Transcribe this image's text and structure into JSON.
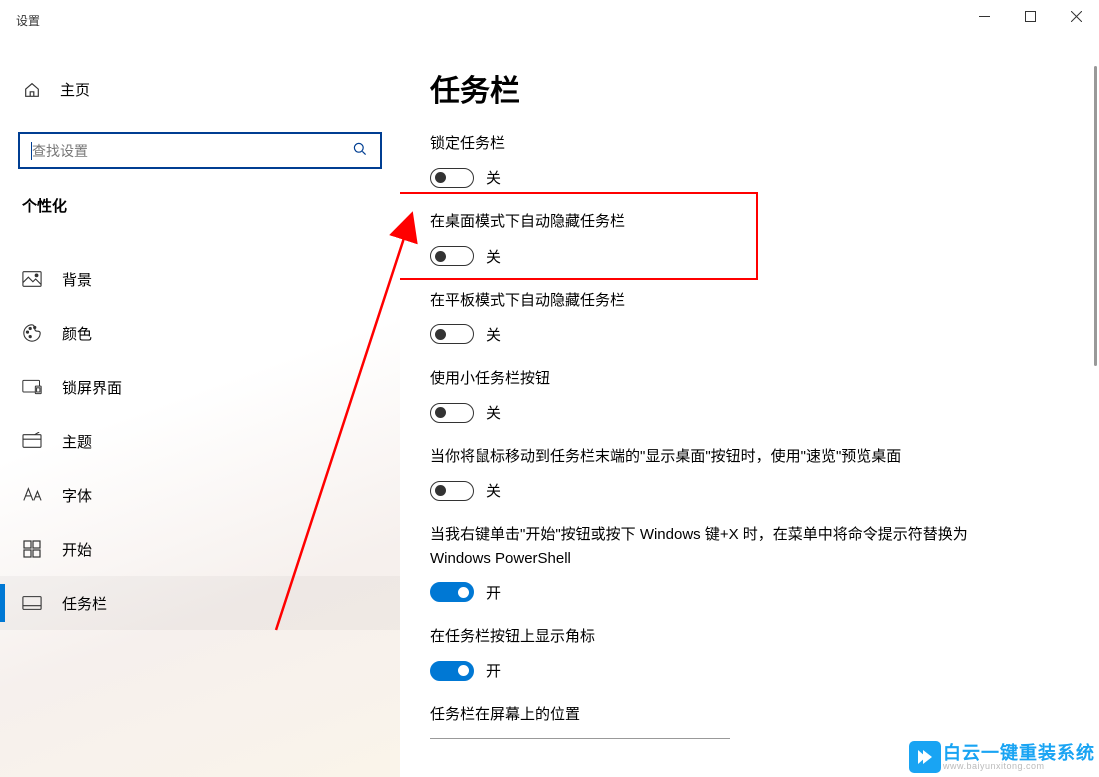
{
  "app_title": "设置",
  "home_label": "主页",
  "search": {
    "placeholder": "查找设置"
  },
  "category": "个性化",
  "sidebar_items": [
    {
      "label": "背景",
      "icon": "picture-icon"
    },
    {
      "label": "颜色",
      "icon": "palette-icon"
    },
    {
      "label": "锁屏界面",
      "icon": "lockscreen-icon"
    },
    {
      "label": "主题",
      "icon": "theme-icon"
    },
    {
      "label": "字体",
      "icon": "font-icon"
    },
    {
      "label": "开始",
      "icon": "start-icon"
    },
    {
      "label": "任务栏",
      "icon": "taskbar-icon",
      "active": true
    }
  ],
  "page_title": "任务栏",
  "settings": [
    {
      "label": "锁定任务栏",
      "state": "off",
      "state_text": "关"
    },
    {
      "label": "在桌面模式下自动隐藏任务栏",
      "state": "off",
      "state_text": "关",
      "highlighted": true
    },
    {
      "label": "在平板模式下自动隐藏任务栏",
      "state": "off",
      "state_text": "关"
    },
    {
      "label": "使用小任务栏按钮",
      "state": "off",
      "state_text": "关"
    },
    {
      "label": "当你将鼠标移动到任务栏末端的\"显示桌面\"按钮时，使用\"速览\"预览桌面",
      "state": "off",
      "state_text": "关"
    },
    {
      "label": "当我右键单击\"开始\"按钮或按下 Windows 键+X 时，在菜单中将命令提示符替换为 Windows PowerShell",
      "state": "on",
      "state_text": "开"
    },
    {
      "label": "在任务栏按钮上显示角标",
      "state": "on",
      "state_text": "开"
    }
  ],
  "section_title_position": "任务栏在屏幕上的位置",
  "titlebar": {
    "min": "–",
    "max": "☐",
    "close": "✕"
  },
  "watermark": {
    "main": "白云一键重装系统",
    "sub": "www.baiyunxitong.com"
  }
}
